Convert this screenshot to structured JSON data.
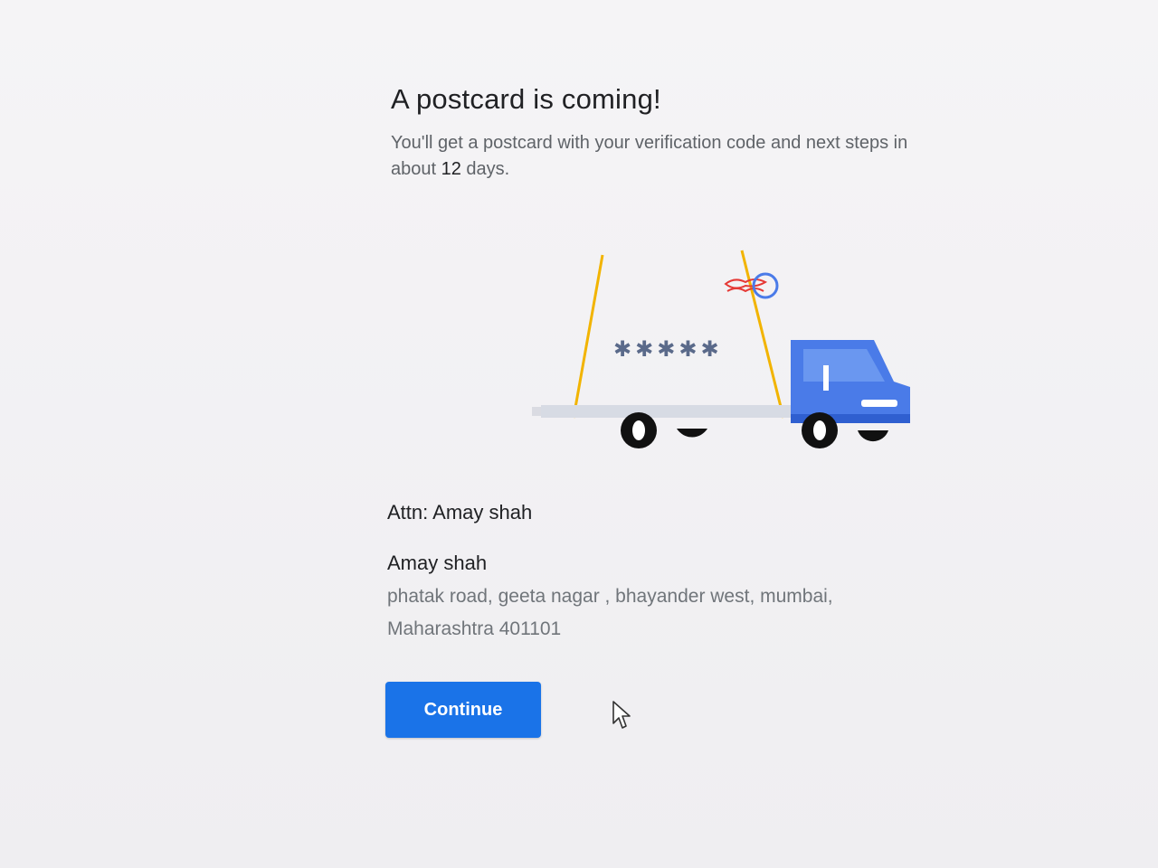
{
  "header": {
    "title": "A postcard is coming!",
    "subtitle_prefix": "You'll get a postcard with your verification code and next steps in about ",
    "subtitle_days": "12",
    "subtitle_suffix": " days."
  },
  "illustration": {
    "masked_code": "✱✱✱✱✱",
    "colors": {
      "truck_blue": "#4a7be8",
      "truck_dark_blue": "#2f5fd0",
      "pole": "#f2b400",
      "wheel": "#111111",
      "red_accent": "#e53935"
    }
  },
  "recipient": {
    "attn": "Attn: Amay shah",
    "name": "Amay shah",
    "address_line1": "phatak road, geeta nagar , bhayander west, mumbai,",
    "address_line2": "Maharashtra 401101"
  },
  "actions": {
    "continue_label": "Continue",
    "primary_color": "#1a73e8"
  }
}
